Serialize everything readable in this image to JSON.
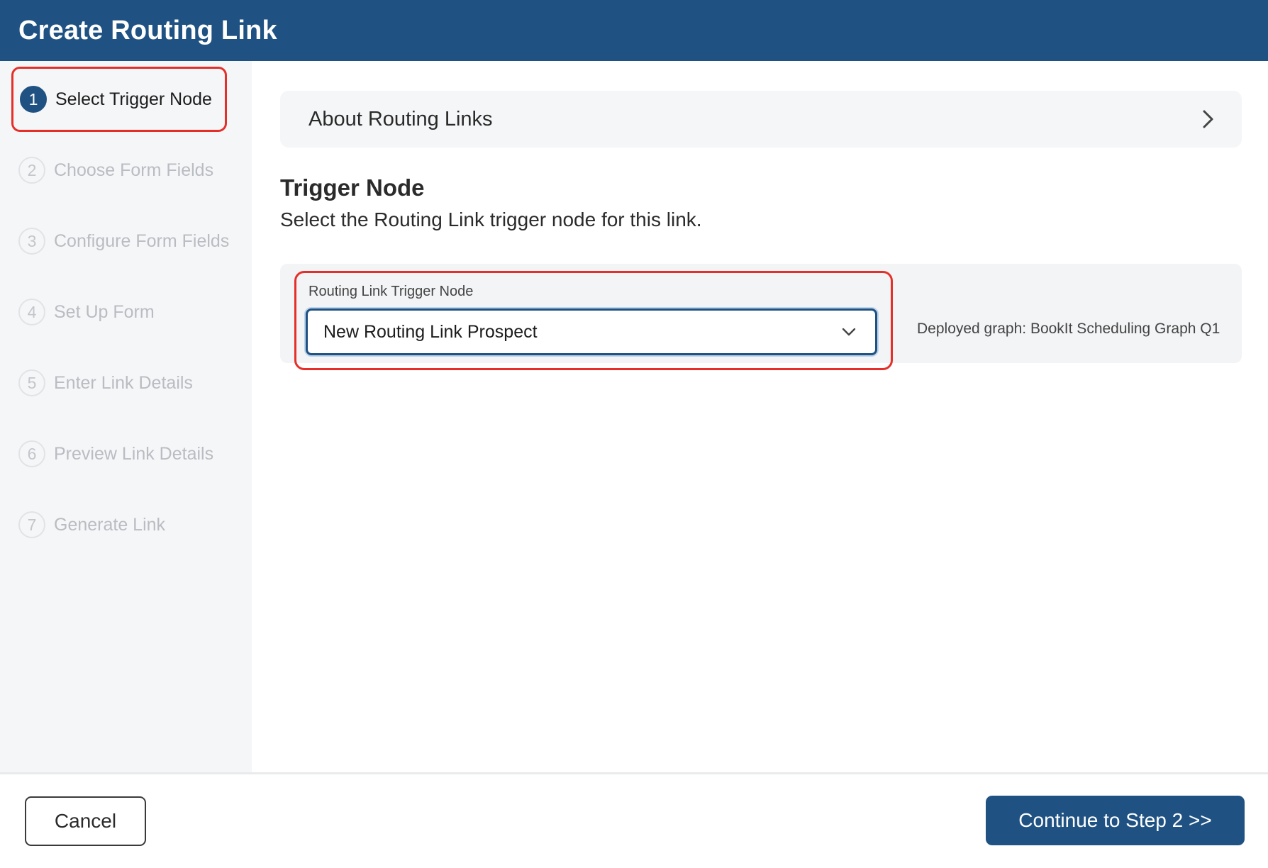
{
  "header": {
    "title": "Create Routing Link"
  },
  "sidebar": {
    "steps": [
      {
        "number": "1",
        "label": "Select Trigger Node",
        "active": true
      },
      {
        "number": "2",
        "label": "Choose Form Fields",
        "active": false
      },
      {
        "number": "3",
        "label": "Configure Form Fields",
        "active": false
      },
      {
        "number": "4",
        "label": "Set Up Form",
        "active": false
      },
      {
        "number": "5",
        "label": "Enter Link Details",
        "active": false
      },
      {
        "number": "6",
        "label": "Preview Link Details",
        "active": false
      },
      {
        "number": "7",
        "label": "Generate Link",
        "active": false
      }
    ]
  },
  "main": {
    "about": {
      "label": "About Routing Links",
      "icon": "chevron-right-icon"
    },
    "section": {
      "title": "Trigger Node",
      "description": "Select the Routing Link trigger node for this link."
    },
    "trigger_field": {
      "label": "Routing Link Trigger Node",
      "value": "New Routing Link Prospect",
      "icon": "chevron-down-icon"
    },
    "deployed_graph": "Deployed graph: BookIt Scheduling Graph Q1"
  },
  "footer": {
    "cancel_label": "Cancel",
    "continue_label": "Continue to Step 2 >>"
  },
  "colors": {
    "brand": "#1f5282",
    "highlight": "#e5302a",
    "sidebar_bg": "#f5f6f8"
  }
}
